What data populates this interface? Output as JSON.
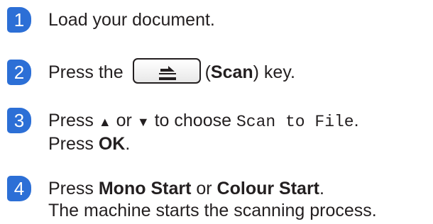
{
  "steps": [
    {
      "num": "1",
      "text": "Load your document."
    },
    {
      "num": "2",
      "pre": "Press the",
      "key_icon": "scan-key-icon",
      "paren_open": "(",
      "bold": "Scan",
      "post": ") key."
    },
    {
      "num": "3",
      "line1_a": "Press",
      "up": "▲",
      "or": "or",
      "down": "▼",
      "line1_b": "to choose",
      "mono": "Scan to File",
      "period": ".",
      "line2_a": "Press",
      "line2_bold": "OK",
      "line2_b": "."
    },
    {
      "num": "4",
      "line1_a": "Press",
      "bold1": "Mono Start",
      "or": "or",
      "bold2": "Colour Start",
      "period": ".",
      "line2": "The machine starts the scanning process."
    }
  ],
  "colors": {
    "badge": "#2c6fd6",
    "text": "#231f20"
  }
}
